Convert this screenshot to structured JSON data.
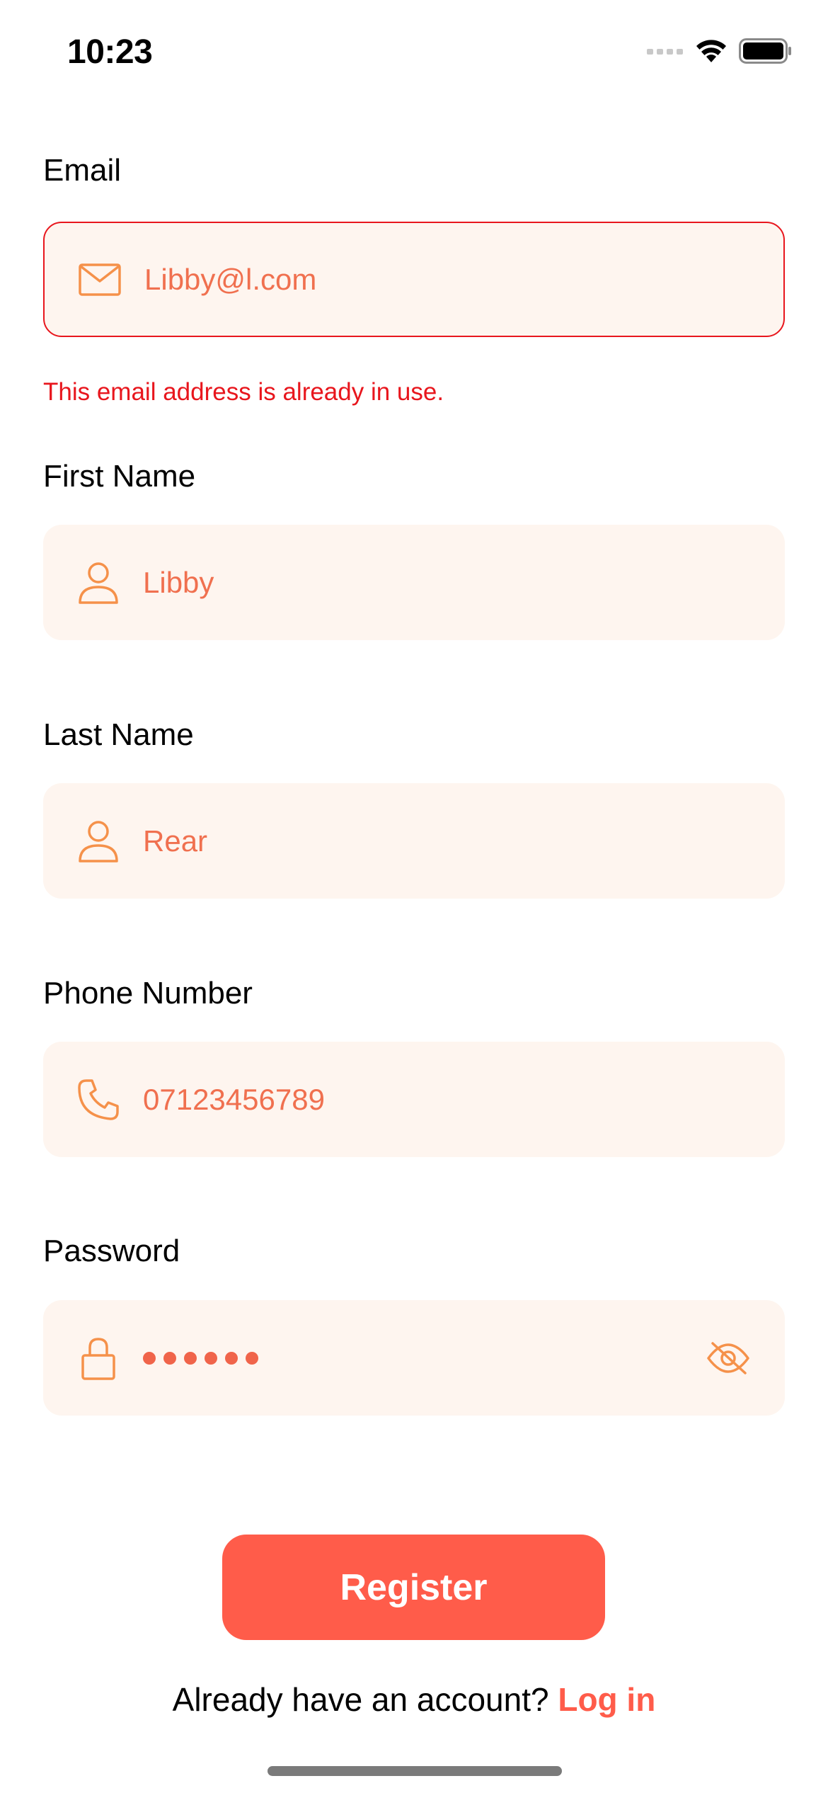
{
  "status_bar": {
    "time": "10:23"
  },
  "form": {
    "email": {
      "label": "Email",
      "value": "Libby@l.com",
      "icon": "envelope-icon",
      "error": "This email address is already in use."
    },
    "first_name": {
      "label": "First Name",
      "value": "Libby",
      "icon": "person-icon"
    },
    "last_name": {
      "label": "Last Name",
      "value": "Rear",
      "icon": "person-icon"
    },
    "phone": {
      "label": "Phone Number",
      "value": "07123456789",
      "icon": "phone-icon"
    },
    "password": {
      "label": "Password",
      "masked_length": 6,
      "icon": "lock-icon",
      "toggle_icon": "eye-slash-icon"
    }
  },
  "actions": {
    "register_label": "Register",
    "login_prompt": "Already have an account?",
    "login_link": "Log in"
  },
  "colors": {
    "accent": "#ff5c4a",
    "field_bg": "#fef5ef",
    "field_text": "#f0704f",
    "icon": "#f5914a",
    "error": "#e8161d"
  }
}
